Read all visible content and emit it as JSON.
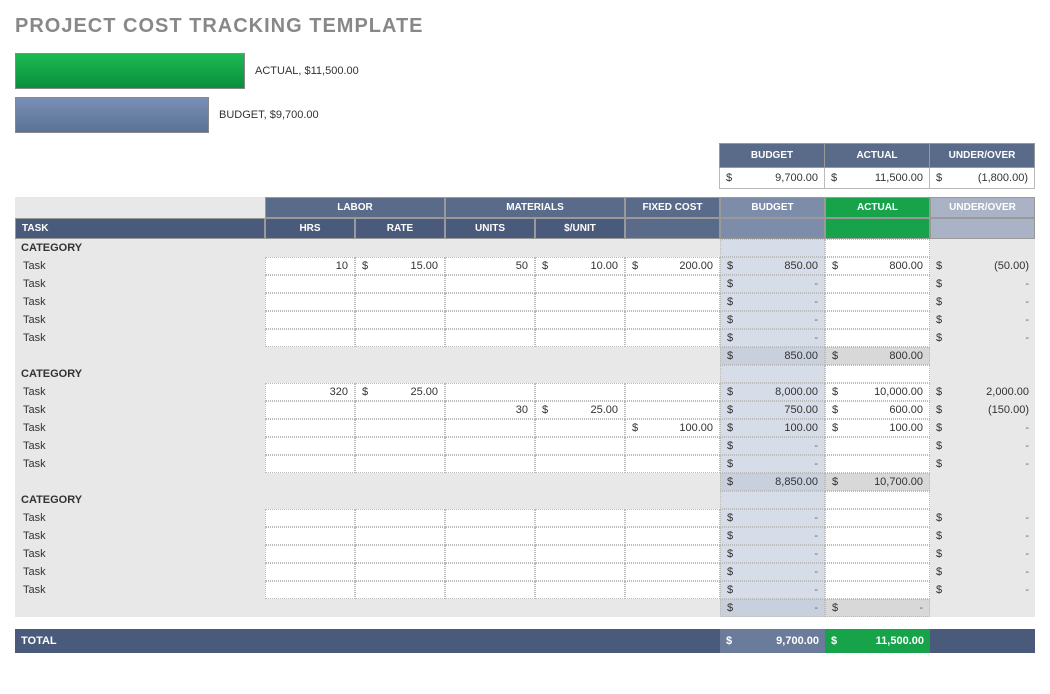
{
  "title": "PROJECT COST TRACKING TEMPLATE",
  "chart_data": {
    "type": "bar",
    "series": [
      {
        "name": "ACTUAL",
        "values": [
          11500.0
        ],
        "label": "ACTUAL,  $11,500.00"
      },
      {
        "name": "BUDGET",
        "values": [
          9700.0
        ],
        "label": "BUDGET,  $9,700.00"
      }
    ]
  },
  "summary": {
    "headers": {
      "budget": "BUDGET",
      "actual": "ACTUAL",
      "under": "UNDER/OVER"
    },
    "budget": "9,700.00",
    "actual": "11,500.00",
    "under": "(1,800.00)"
  },
  "headers": {
    "task": "TASK",
    "labor": "LABOR",
    "materials": "MATERIALS",
    "fixed": "FIXED COST",
    "budget": "BUDGET",
    "actual": "ACTUAL",
    "under": "UNDER/OVER",
    "hrs": "HRS",
    "rate": "RATE",
    "units": "UNITS",
    "per": "$/UNIT"
  },
  "categories": [
    {
      "name": "CATEGORY",
      "tasks": [
        {
          "name": "Task",
          "hrs": "10",
          "rate": "15.00",
          "units": "50",
          "per": "10.00",
          "fixed": "200.00",
          "budget": "850.00",
          "actual": "800.00",
          "under": "(50.00)"
        },
        {
          "name": "Task",
          "hrs": "",
          "rate": "",
          "units": "",
          "per": "",
          "fixed": "",
          "budget": "-",
          "actual": "",
          "under": "-"
        },
        {
          "name": "Task",
          "hrs": "",
          "rate": "",
          "units": "",
          "per": "",
          "fixed": "",
          "budget": "-",
          "actual": "",
          "under": "-"
        },
        {
          "name": "Task",
          "hrs": "",
          "rate": "",
          "units": "",
          "per": "",
          "fixed": "",
          "budget": "-",
          "actual": "",
          "under": "-"
        },
        {
          "name": "Task",
          "hrs": "",
          "rate": "",
          "units": "",
          "per": "",
          "fixed": "",
          "budget": "-",
          "actual": "",
          "under": "-"
        }
      ],
      "subtotal": {
        "budget": "850.00",
        "actual": "800.00"
      }
    },
    {
      "name": "CATEGORY",
      "tasks": [
        {
          "name": "Task",
          "hrs": "320",
          "rate": "25.00",
          "units": "",
          "per": "",
          "fixed": "",
          "budget": "8,000.00",
          "actual": "10,000.00",
          "under": "2,000.00"
        },
        {
          "name": "Task",
          "hrs": "",
          "rate": "",
          "units": "30",
          "per": "25.00",
          "fixed": "",
          "budget": "750.00",
          "actual": "600.00",
          "under": "(150.00)"
        },
        {
          "name": "Task",
          "hrs": "",
          "rate": "",
          "units": "",
          "per": "",
          "fixed": "100.00",
          "budget": "100.00",
          "actual": "100.00",
          "under": "-"
        },
        {
          "name": "Task",
          "hrs": "",
          "rate": "",
          "units": "",
          "per": "",
          "fixed": "",
          "budget": "-",
          "actual": "",
          "under": "-"
        },
        {
          "name": "Task",
          "hrs": "",
          "rate": "",
          "units": "",
          "per": "",
          "fixed": "",
          "budget": "-",
          "actual": "",
          "under": "-"
        }
      ],
      "subtotal": {
        "budget": "8,850.00",
        "actual": "10,700.00"
      }
    },
    {
      "name": "CATEGORY",
      "tasks": [
        {
          "name": "Task",
          "hrs": "",
          "rate": "",
          "units": "",
          "per": "",
          "fixed": "",
          "budget": "-",
          "actual": "",
          "under": "-"
        },
        {
          "name": "Task",
          "hrs": "",
          "rate": "",
          "units": "",
          "per": "",
          "fixed": "",
          "budget": "-",
          "actual": "",
          "under": "-"
        },
        {
          "name": "Task",
          "hrs": "",
          "rate": "",
          "units": "",
          "per": "",
          "fixed": "",
          "budget": "-",
          "actual": "",
          "under": "-"
        },
        {
          "name": "Task",
          "hrs": "",
          "rate": "",
          "units": "",
          "per": "",
          "fixed": "",
          "budget": "-",
          "actual": "",
          "under": "-"
        },
        {
          "name": "Task",
          "hrs": "",
          "rate": "",
          "units": "",
          "per": "",
          "fixed": "",
          "budget": "-",
          "actual": "",
          "under": "-"
        }
      ],
      "subtotal": {
        "budget": "-",
        "actual": "-"
      }
    }
  ],
  "total": {
    "label": "TOTAL",
    "budget": "9,700.00",
    "actual": "11,500.00"
  }
}
